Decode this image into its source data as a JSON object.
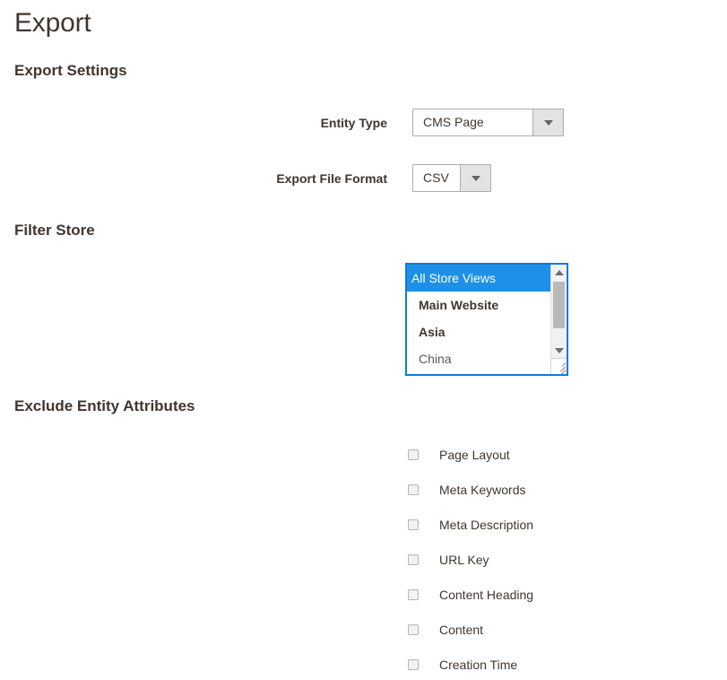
{
  "page": {
    "title": "Export"
  },
  "sections": {
    "export_settings": {
      "heading": "Export Settings",
      "fields": [
        {
          "label": "Entity Type",
          "value": "CMS Page",
          "arrow_icon": "chevron-down-icon"
        },
        {
          "label": "Export File Format",
          "value": "CSV",
          "arrow_icon": "chevron-down-icon"
        }
      ]
    },
    "filter_store": {
      "heading": "Filter Store",
      "store_list": {
        "items": [
          {
            "label": "All Store Views",
            "level": 0,
            "selected": true
          },
          {
            "label": "Main Website",
            "level": 1,
            "selected": false
          },
          {
            "label": "Asia",
            "level": 2,
            "selected": false
          },
          {
            "label": "China",
            "level": 3,
            "selected": false
          }
        ],
        "scrollbar": {
          "up_arrow_icon": "triangle-up-icon",
          "down_arrow_icon": "triangle-down-icon",
          "resizer_icon": "resize-grip-icon"
        }
      }
    },
    "exclude_attributes": {
      "heading": "Exclude Entity Attributes",
      "checkboxes": [
        {
          "label": "Page Layout",
          "checked": false
        },
        {
          "label": "Meta Keywords",
          "checked": false
        },
        {
          "label": "Meta Description",
          "checked": false
        },
        {
          "label": "URL Key",
          "checked": false
        },
        {
          "label": "Content Heading",
          "checked": false
        },
        {
          "label": "Content",
          "checked": false
        },
        {
          "label": "Creation Time",
          "checked": false
        }
      ]
    }
  },
  "colors": {
    "text": "#41362f",
    "selection_blue": "#1e90e8",
    "focus_border_blue": "#0e7ae0",
    "select_button_gray": "#e3e3e3",
    "background": "#ffffff"
  }
}
